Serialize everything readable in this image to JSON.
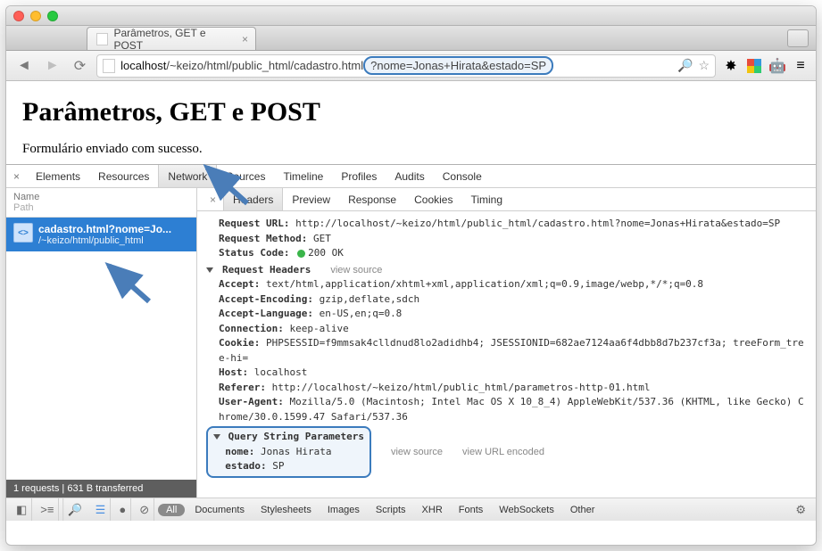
{
  "browser": {
    "tab_title": "Parâmetros, GET e POST",
    "url_host": "localhost",
    "url_path": "/~keizo/html/public_html/cadastro.html",
    "url_query_highlight": "?nome=Jonas+Hirata&estado=SP"
  },
  "page": {
    "heading": "Parâmetros, GET e POST",
    "message": "Formulário enviado com sucesso."
  },
  "devtools": {
    "tabs": [
      "Elements",
      "Resources",
      "Network",
      "Sources",
      "Timeline",
      "Profiles",
      "Audits",
      "Console"
    ],
    "active_tab": "Network",
    "request_list": {
      "header_name": "Name",
      "header_path": "Path",
      "items": [
        {
          "name": "cadastro.html?nome=Jo...",
          "path": "/~keizo/html/public_html"
        }
      ],
      "status": "1 requests  |  631 B transferred"
    },
    "detail": {
      "subtabs": [
        "Headers",
        "Preview",
        "Response",
        "Cookies",
        "Timing"
      ],
      "active_subtab": "Headers",
      "request_url_label": "Request URL:",
      "request_url": "http://localhost/~keizo/html/public_html/cadastro.html?nome=Jonas+Hirata&estado=SP",
      "request_method_label": "Request Method:",
      "request_method": "GET",
      "status_code_label": "Status Code:",
      "status_code": "200 OK",
      "request_headers_label": "Request Headers",
      "view_source": "view source",
      "view_url_encoded": "view URL encoded",
      "headers": {
        "Accept": "text/html,application/xhtml+xml,application/xml;q=0.9,image/webp,*/*;q=0.8",
        "Accept-Encoding": "gzip,deflate,sdch",
        "Accept-Language": "en-US,en;q=0.8",
        "Connection": "keep-alive",
        "Cookie": "PHPSESSID=f9mmsak4clldnud8lo2adidhb4; JSESSIONID=682ae7124aa6f4dbb8d7b237cf3a; treeForm_tree-hi=",
        "Host": "localhost",
        "Referer": "http://localhost/~keizo/html/public_html/parametros-http-01.html",
        "User-Agent": "Mozilla/5.0 (Macintosh; Intel Mac OS X 10_8_4) AppleWebKit/537.36 (KHTML, like Gecko) Chrome/30.0.1599.47 Safari/537.36"
      },
      "qsp_label": "Query String Parameters",
      "qsp": {
        "nome": "Jonas Hirata",
        "estado": "SP"
      }
    },
    "footer": {
      "all": "All",
      "filters": [
        "Documents",
        "Stylesheets",
        "Images",
        "Scripts",
        "XHR",
        "Fonts",
        "WebSockets",
        "Other"
      ]
    }
  }
}
